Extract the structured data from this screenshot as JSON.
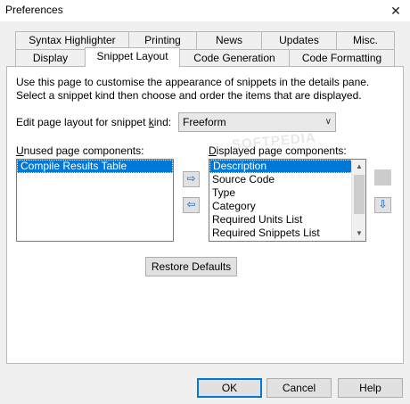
{
  "window": {
    "title": "Preferences",
    "close_glyph": "✕"
  },
  "tabs": {
    "row1": [
      {
        "label": "Syntax Highlighter"
      },
      {
        "label": "Printing"
      },
      {
        "label": "News"
      },
      {
        "label": "Updates"
      },
      {
        "label": "Misc."
      }
    ],
    "row2": [
      {
        "label": "Display"
      },
      {
        "label": "Snippet Layout",
        "active": true
      },
      {
        "label": "Code Generation"
      },
      {
        "label": "Code Formatting"
      }
    ]
  },
  "panel": {
    "intro": "Use this page to customise the appearance of snippets in the details pane. Select a snippet kind then choose and order the items that are displayed.",
    "kind_label_pre": "Edit page layout for snippet ",
    "kind_label_acc": "k",
    "kind_label_post": "ind:",
    "kind_value": "Freeform",
    "unused_label_acc": "U",
    "unused_label_rest": "nused page components:",
    "displayed_label_acc": "D",
    "displayed_label_rest": "isplayed page components:",
    "unused_items": [
      "Compile Results Table"
    ],
    "displayed_items": [
      "Description",
      "Source Code",
      "Type",
      "Category",
      "Required Units List",
      "Required Snippets List"
    ],
    "restore_label": "Restore Defaults"
  },
  "arrows": {
    "right": "⇨",
    "left": "⇦",
    "up": "⇧",
    "down": "⇩"
  },
  "buttons": {
    "ok": "OK",
    "cancel": "Cancel",
    "help": "Help"
  },
  "watermark": "SOFTPEDIA",
  "colors": {
    "selection": "#0078d7",
    "window_bg": "#f0f0f0"
  }
}
